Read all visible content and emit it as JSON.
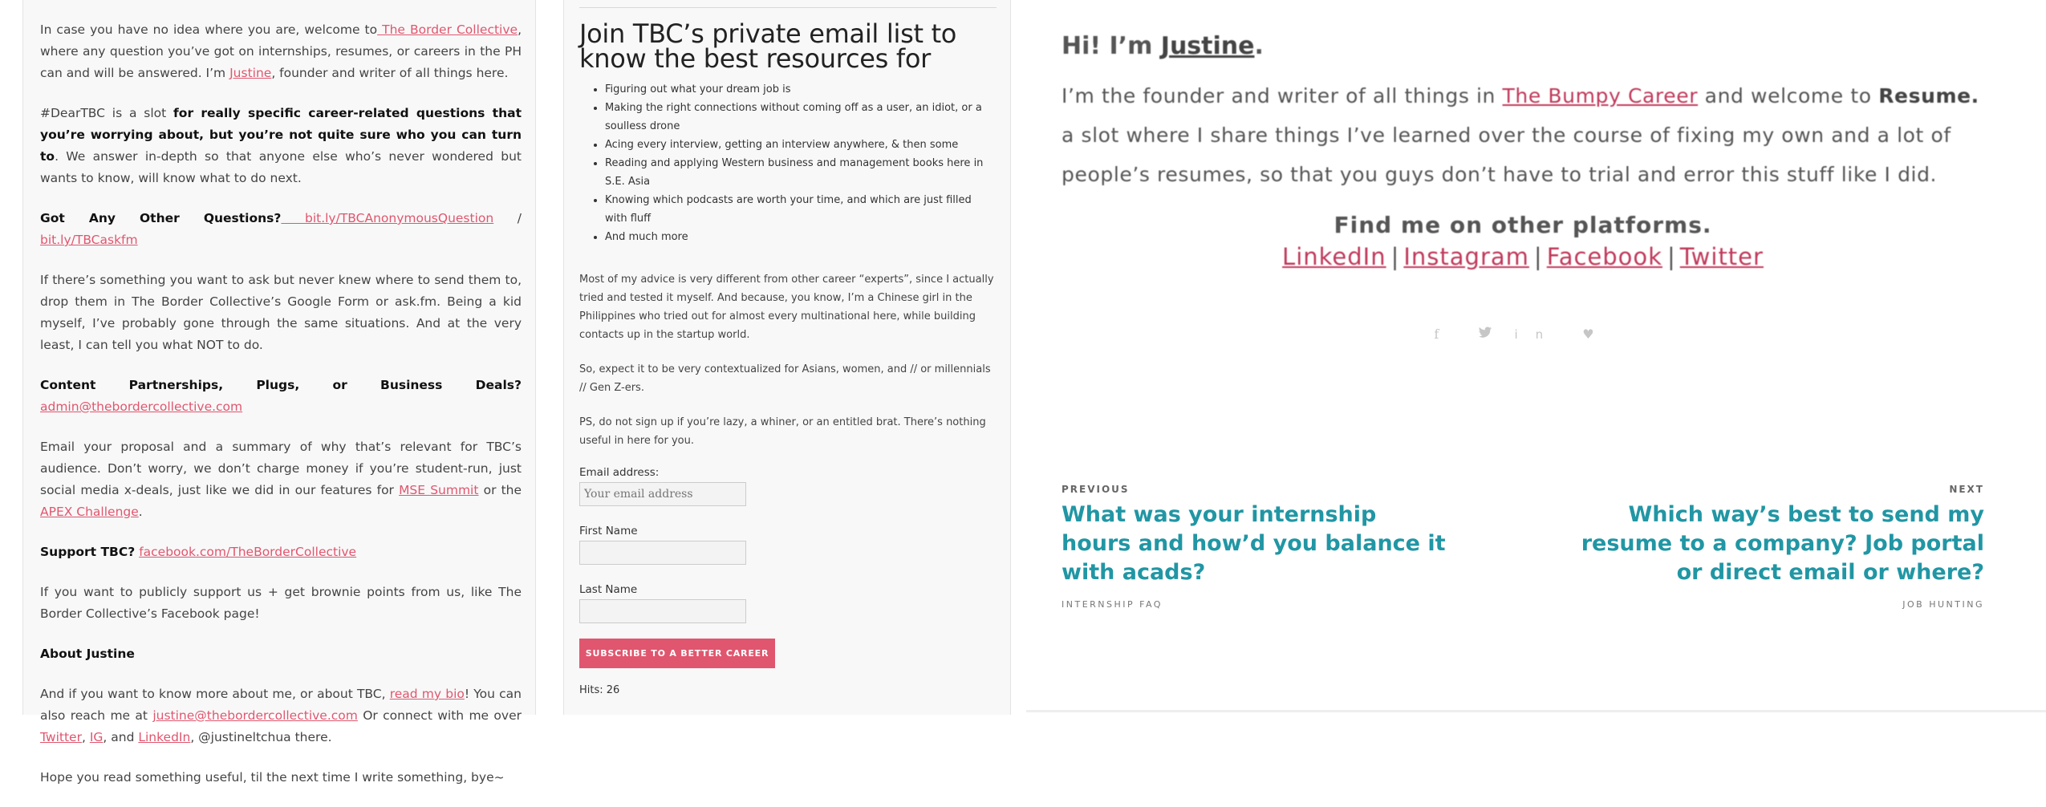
{
  "left": {
    "p1": {
      "before": "In case you have no idea where you are, welcome to",
      "link_tbc": " The Border Collective",
      "middle": ", where any question you’ve got on internships, resumes, or careers in the PH can and will be answered. I’m ",
      "link_justine": "Justine",
      "after": ", founder and writer of all things here."
    },
    "p2": {
      "before": "#DearTBC is a slot ",
      "bold": "for really specific career-related questions that you’re worrying about, but you’re not quite sure who you can turn to",
      "after": ". We answer in-depth so that anyone else who’s never wondered but wants to know, will know what to do next."
    },
    "p3": {
      "bold": "Got Any Other Questions?",
      "link1": " bit.ly/TBCAnonymousQuestion",
      "sep": " / ",
      "link2": " bit.ly/TBCaskfm"
    },
    "p4": "If there’s something you want to ask but never knew where to send them to, drop them in The Border Collective’s Google Form or ask.fm. Being a kid myself, I’ve probably gone through the same situations. And at the very least, I can tell you what NOT to do.",
    "p5": {
      "bold": "Content Partnerships, Plugs, or Business Deals?",
      "link": "admin@thebordercollective.com"
    },
    "p6": {
      "before": "Email your proposal and a summary of why that’s relevant for TBC’s audience. Don’t worry, we don’t charge money if you’re student-run, just social media x-deals, just like we did in our features for ",
      "link1": "MSE Summit",
      "middle": " or the ",
      "link2": "APEX Challenge",
      "after": "."
    },
    "p7": {
      "bold": "Support TBC?",
      "link": "facebook.com/TheBorderCollective"
    },
    "p8": "If you want to publicly support us + get brownie points from us, like The Border Collective’s Facebook page!",
    "p9": "About Justine",
    "p10": {
      "t1": "And if you want to know more about me, or about TBC, ",
      "link_bio": "read my bio",
      "t2": "! You can also reach me at ",
      "link_email": "justine@thebordercollective.com",
      "t3": " Or connect with me over ",
      "link_twitter": "Twitter",
      "t4": ", ",
      "link_ig": "IG",
      "t5": ", and ",
      "link_linkedin": "LinkedIn",
      "t6": ", @justineltchua there."
    },
    "p11": "Hope you read something useful, til the next time I write something, bye~"
  },
  "middle": {
    "title": "Join TBC’s private email list to know the best resources for",
    "bullets": [
      "Figuring out what your dream job is",
      "Making the right connections without coming off as a user, an idiot, or a soulless drone",
      "Acing every interview, getting an interview anywhere, & then some",
      "Reading and applying Western business and management books here in S.E. Asia",
      "Knowing which podcasts are worth your time, and which are just filled with fluff",
      "And much more"
    ],
    "para1": "Most of my advice is very different from other career “experts”, since I actually tried and tested it myself. And because, you know, I’m a Chinese girl in the Philippines who tried out for almost every multinational here, while building contacts up in the startup world.",
    "para2": "So, expect it to be very contextualized for Asians, women, and // or millennials // Gen Z-ers.",
    "para3": "PS, do not sign up if you’re lazy, a whiner, or an entitled brat. There’s nothing useful in here for you.",
    "email_label": "Email address:",
    "email_placeholder": "Your email address",
    "first_name_label": "First Name",
    "last_name_label": "Last Name",
    "subscribe_label": "SUBSCRIBE TO A BETTER CAREER",
    "hits": "Hits: 26"
  },
  "right": {
    "greeting_prefix": "Hi! I’m ",
    "greeting_name": "Justine",
    "greeting_suffix": ".",
    "intro_before": "I’m the founder and writer of all things in ",
    "intro_link": "The Bumpy Career",
    "intro_middle": " and welcome to ",
    "intro_bold": "Resume.",
    "intro_after": " a slot where I share things I’ve learned over the course of fixing my own and a lot of people’s resumes, so that you guys don’t have to trial and error this stuff like I did.",
    "find_me": "Find me on other platforms.",
    "platforms": [
      "LinkedIn",
      "Instagram",
      "Facebook",
      "Twitter"
    ],
    "share_icons": [
      "facebook-icon",
      "twitter-icon",
      "linkedin-icon",
      "heart-icon"
    ],
    "prev": {
      "kicker": "PREVIOUS",
      "title": "What was your internship hours and how’d you balance it with acads?",
      "category": "INTERNSHIP FAQ"
    },
    "next": {
      "kicker": "NEXT",
      "title": "Which way’s best to send my resume to a company? Job portal or direct email or where?",
      "category": "JOB HUNTING"
    }
  },
  "colors": {
    "link": "#e0566e",
    "button": "#e0566e",
    "nav_title": "#2196a4",
    "intro_link": "#c0395a"
  }
}
